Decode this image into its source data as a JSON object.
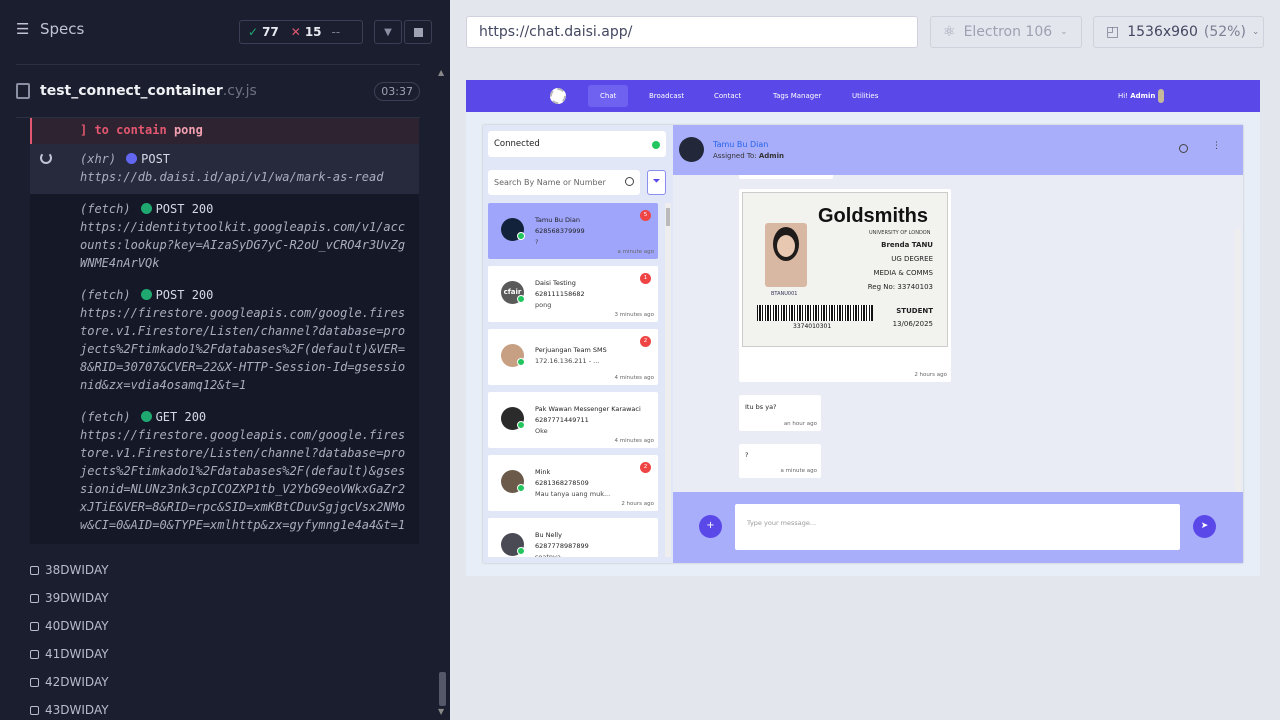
{
  "runner": {
    "specs_label": "Specs",
    "passed": "77",
    "failed": "15",
    "pending": "--",
    "file_name": "test_connect_container",
    "file_ext": ".cy.js",
    "duration": "03:37"
  },
  "log": {
    "error_part1": "] to contain",
    "error_part2": "pong",
    "entries": [
      {
        "type": "(xhr)",
        "method": "POST",
        "url": "https://db.daisi.id/api/v1/wa/mark-as-read",
        "dot": "#6366f1"
      },
      {
        "type": "(fetch)",
        "method": "POST 200",
        "url": "https://identitytoolkit.googleapis.com/v1/accounts:lookup?key=AIzaSyDG7yC-R2oU_vCRO4r3UvZgWNME4nArVQk",
        "dot": "#1fa971"
      },
      {
        "type": "(fetch)",
        "method": "POST 200",
        "url": "https://firestore.googleapis.com/google.firestore.v1.Firestore/Listen/channel?database=projects%2Ftimkado1%2Fdatabases%2F(default)&VER=8&RID=30707&CVER=22&X-HTTP-Session-Id=gsessionid&zx=vdia4osamq12&t=1",
        "dot": "#1fa971"
      },
      {
        "type": "(fetch)",
        "method": "GET 200",
        "url": "https://firestore.googleapis.com/google.firestore.v1.Firestore/Listen/channel?database=projects%2Ftimkado1%2Fdatabases%2F(default)&gsessionid=NLUNz3nk3cpICOZXP1tb_V2YbG9eoVWkxGaZr2xJTiE&VER=8&RID=rpc&SID=xmKBtCDuvSgjgcVsx2NMow&CI=0&AID=0&TYPE=xmlhttp&zx=gyfymng1e4a4&t=1",
        "dot": "#1fa971"
      }
    ],
    "suites": [
      "38DWIDAY",
      "39DWIDAY",
      "40DWIDAY",
      "41DWIDAY",
      "42DWIDAY",
      "43DWIDAY"
    ]
  },
  "browser": {
    "url": "https://chat.daisi.app/",
    "engine": "Electron 106",
    "viewport": "1536x960",
    "zoom": "(52%)"
  },
  "app": {
    "nav": [
      "Chat",
      "Broadcast",
      "Contact",
      "Tags Manager",
      "Utilities"
    ],
    "greet": "Hi!",
    "user": "Admin",
    "status": "Connected",
    "search_placeholder": "Search By Name or Number",
    "contacts": [
      {
        "name": "Tamu Bu Dian",
        "phone": "628568379999",
        "msg": "?",
        "time": "a minute ago",
        "badge": "5"
      },
      {
        "name": "Daisi Testing",
        "phone": "628111158682",
        "msg": "pong",
        "time": "3 minutes ago",
        "badge": "1"
      },
      {
        "name": "Perjuangan Team SMS",
        "phone": "",
        "msg": "172.16.136.211 - ...",
        "time": "4 minutes ago",
        "badge": "2"
      },
      {
        "name": "Pak Wawan Messenger Karawaci",
        "phone": "6287771449711",
        "msg": "Oke",
        "time": "4 minutes ago",
        "badge": ""
      },
      {
        "name": "Mink",
        "phone": "6281368278509",
        "msg": "Mau tanya uang muk...",
        "time": "2 hours ago",
        "badge": "2"
      },
      {
        "name": "Bu Nelly",
        "phone": "6287778987899",
        "msg": "seatnya",
        "time": "",
        "badge": ""
      }
    ],
    "chat_name": "Tamu Bu Dian",
    "assigned_label": "Assigned To:",
    "assigned_to": "Admin",
    "card": {
      "institution": "Goldsmiths",
      "university": "UNIVERSITY OF LONDON",
      "student_name": "Brenda TANU",
      "degree": "UG DEGREE",
      "dept": "MEDIA & COMMS",
      "reg": "Reg No: 33740103",
      "role": "STUDENT",
      "date": "13/06/2025",
      "barcode": "3374010301",
      "photo_tag": "BTANU001"
    },
    "messages": [
      {
        "text": "",
        "time": "2 hours ago"
      },
      {
        "text": "Itu bs ya?",
        "time": "an hour ago"
      },
      {
        "text": "?",
        "time": "a minute ago"
      }
    ],
    "compose_placeholder": "Type your message..."
  }
}
